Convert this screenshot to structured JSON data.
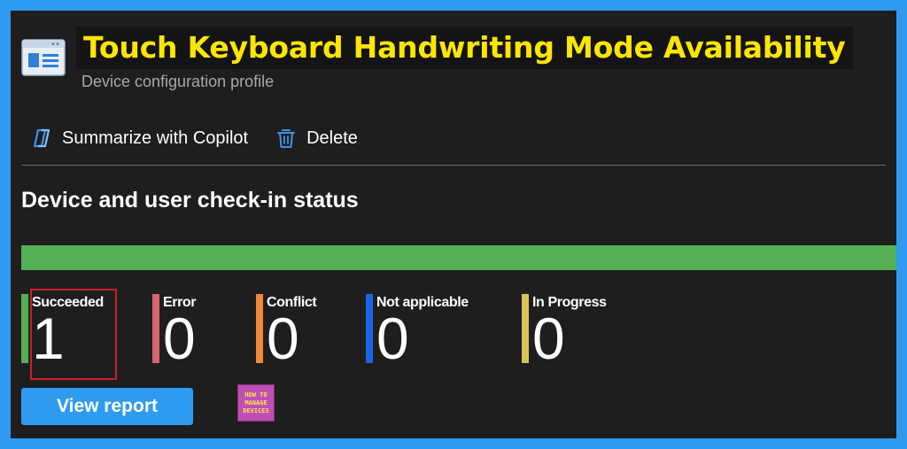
{
  "header": {
    "icon": "config-profile-icon",
    "title": "Touch Keyboard Handwriting Mode Availability",
    "subtitle": "Device configuration profile"
  },
  "toolbar": {
    "copilot_label": "Summarize with Copilot",
    "copilot_icon": "copilot-icon",
    "delete_label": "Delete",
    "delete_icon": "trash-icon"
  },
  "status": {
    "section_title": "Device and user check-in status",
    "bar_color": "#54b054",
    "items": [
      {
        "label": "Succeeded",
        "value": "1",
        "color": "#54b054"
      },
      {
        "label": "Error",
        "value": "0",
        "color": "#d9646f"
      },
      {
        "label": "Conflict",
        "value": "0",
        "color": "#f08a3a"
      },
      {
        "label": "Not applicable",
        "value": "0",
        "color": "#1c64e6"
      },
      {
        "label": "In Progress",
        "value": "0",
        "color": "#d9c25a"
      }
    ]
  },
  "actions": {
    "view_report_label": "View report"
  },
  "logo": {
    "line1": "HOW TO",
    "line2": "MANAGE",
    "line3": "DEVICES",
    "color": "#c04fb4"
  }
}
